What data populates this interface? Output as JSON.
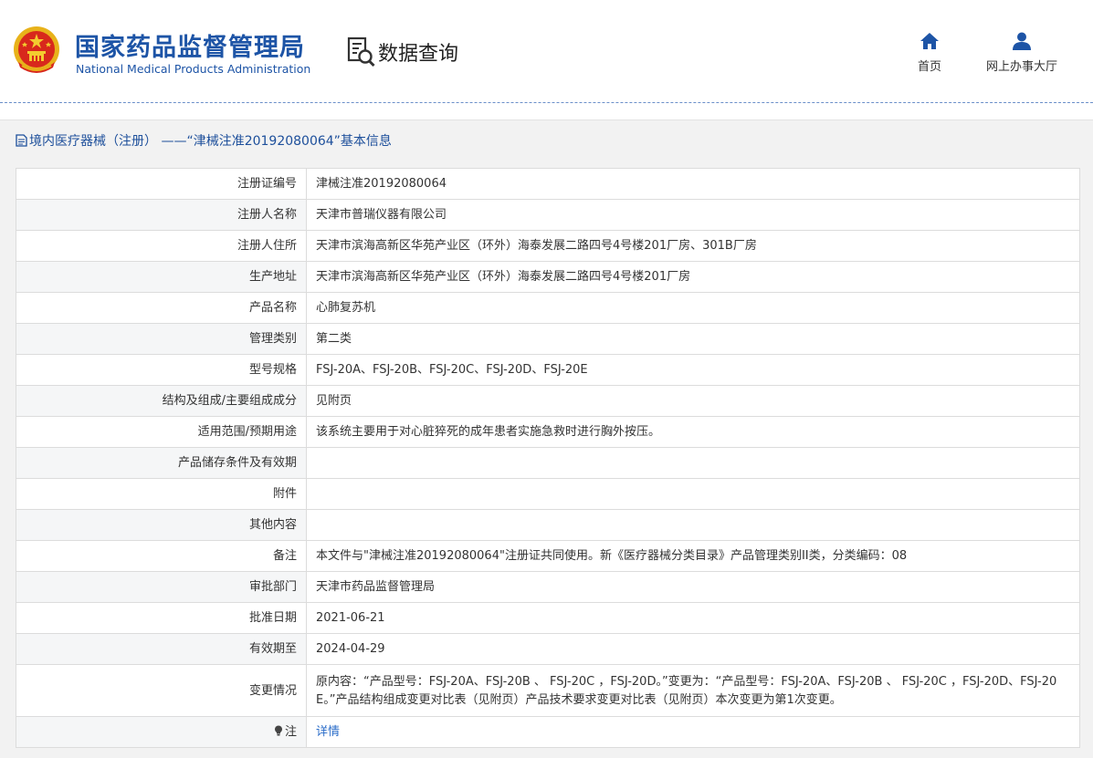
{
  "header": {
    "title_cn": "国家药品监督管理局",
    "title_en": "National Medical Products Administration",
    "query_label": "数据查询",
    "nav": {
      "home": "首页",
      "service_hall": "网上办事大厅"
    }
  },
  "panel": {
    "title": "境内医疗器械（注册） ——“津械注准20192080064”基本信息"
  },
  "rows": [
    {
      "label": "注册证编号",
      "value": "津械注准20192080064"
    },
    {
      "label": "注册人名称",
      "value": "天津市普瑞仪器有限公司"
    },
    {
      "label": "注册人住所",
      "value": "天津市滨海高新区华苑产业区（环外）海泰发展二路四号4号楼201厂房、301B厂房"
    },
    {
      "label": "生产地址",
      "value": "天津市滨海高新区华苑产业区（环外）海泰发展二路四号4号楼201厂房"
    },
    {
      "label": "产品名称",
      "value": "心肺复苏机"
    },
    {
      "label": "管理类别",
      "value": "第二类"
    },
    {
      "label": "型号规格",
      "value": "FSJ-20A、FSJ-20B、FSJ-20C、FSJ-20D、FSJ-20E"
    },
    {
      "label": "结构及组成/主要组成成分",
      "value": "见附页"
    },
    {
      "label": "适用范围/预期用途",
      "value": "该系统主要用于对心脏猝死的成年患者实施急救时进行胸外按压。"
    },
    {
      "label": "产品储存条件及有效期",
      "value": ""
    },
    {
      "label": "附件",
      "value": ""
    },
    {
      "label": "其他内容",
      "value": ""
    },
    {
      "label": "备注",
      "value": "本文件与\"津械注准20192080064\"注册证共同使用。新《医疗器械分类目录》产品管理类别II类，分类编码：08"
    },
    {
      "label": "审批部门",
      "value": "天津市药品监督管理局"
    },
    {
      "label": "批准日期",
      "value": "2021-06-21"
    },
    {
      "label": "有效期至",
      "value": "2024-04-29"
    },
    {
      "label": "变更情况",
      "value": "原内容：“产品型号：FSJ-20A、FSJ-20B 、 FSJ-20C ，FSJ-20D。”变更为：“产品型号：FSJ-20A、FSJ-20B 、 FSJ-20C ，FSJ-20D、FSJ-20E。”产品结构组成变更对比表（见附页）产品技术要求变更对比表（见附页）本次变更为第1次变更。"
    }
  ],
  "note_row": {
    "label": "注",
    "link": "详情"
  },
  "colors": {
    "brand_blue": "#1d54a6",
    "link_blue": "#2b6dc9",
    "panel_bg": "#f2f2f2"
  },
  "icons": [
    "national-emblem-icon",
    "search-document-icon",
    "home-icon",
    "user-icon",
    "document-icon",
    "bulb-icon"
  ]
}
